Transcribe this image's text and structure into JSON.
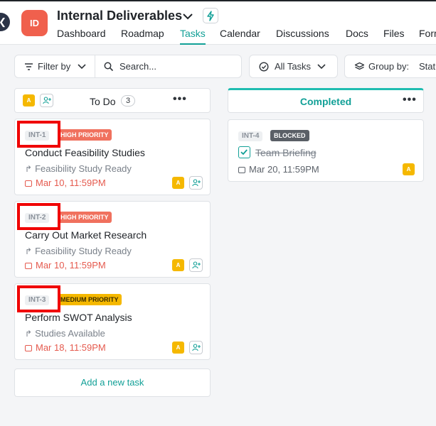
{
  "project": {
    "badge": "ID",
    "title": "Internal Deliverables"
  },
  "nav": {
    "tabs": [
      "Dashboard",
      "Roadmap",
      "Tasks",
      "Calendar",
      "Discussions",
      "Docs",
      "Files",
      "Forms"
    ],
    "active": "Tasks"
  },
  "toolbar": {
    "filter_label": "Filter by",
    "search_placeholder": "Search...",
    "all_tasks_label": "All Tasks",
    "group_by_label": "Group by:",
    "group_by_value": "Status"
  },
  "columns": {
    "todo": {
      "title": "To Do",
      "count": "3",
      "avatar": "A"
    },
    "done": {
      "title": "Completed"
    }
  },
  "todo_cards": [
    {
      "id": "INT-1",
      "priority": "HIGH PRIORITY",
      "title": "Conduct Feasibility Studies",
      "subtitle": "Feasibility Study Ready",
      "date": "Mar 10, 11:59PM",
      "avatar": "A"
    },
    {
      "id": "INT-2",
      "priority": "HIGH PRIORITY",
      "title": "Carry Out Market Research",
      "subtitle": "Feasibility Study Ready",
      "date": "Mar 10, 11:59PM",
      "avatar": "A"
    },
    {
      "id": "INT-3",
      "priority": "MEDIUM PRIORITY",
      "title": "Perform SWOT Analysis",
      "subtitle": "Studies Available",
      "date": "Mar 18, 11:59PM",
      "avatar": "A"
    }
  ],
  "done_cards": [
    {
      "id": "INT-4",
      "status": "BLOCKED",
      "title": "Team Briefing",
      "date": "Mar 20, 11:59PM",
      "avatar": "A"
    }
  ],
  "add_task_label": "Add a new task",
  "colors": {
    "accent": "#12a097",
    "high_priority": "#f0715e",
    "medium_priority": "#f5b800",
    "highlight": "#f00000"
  }
}
